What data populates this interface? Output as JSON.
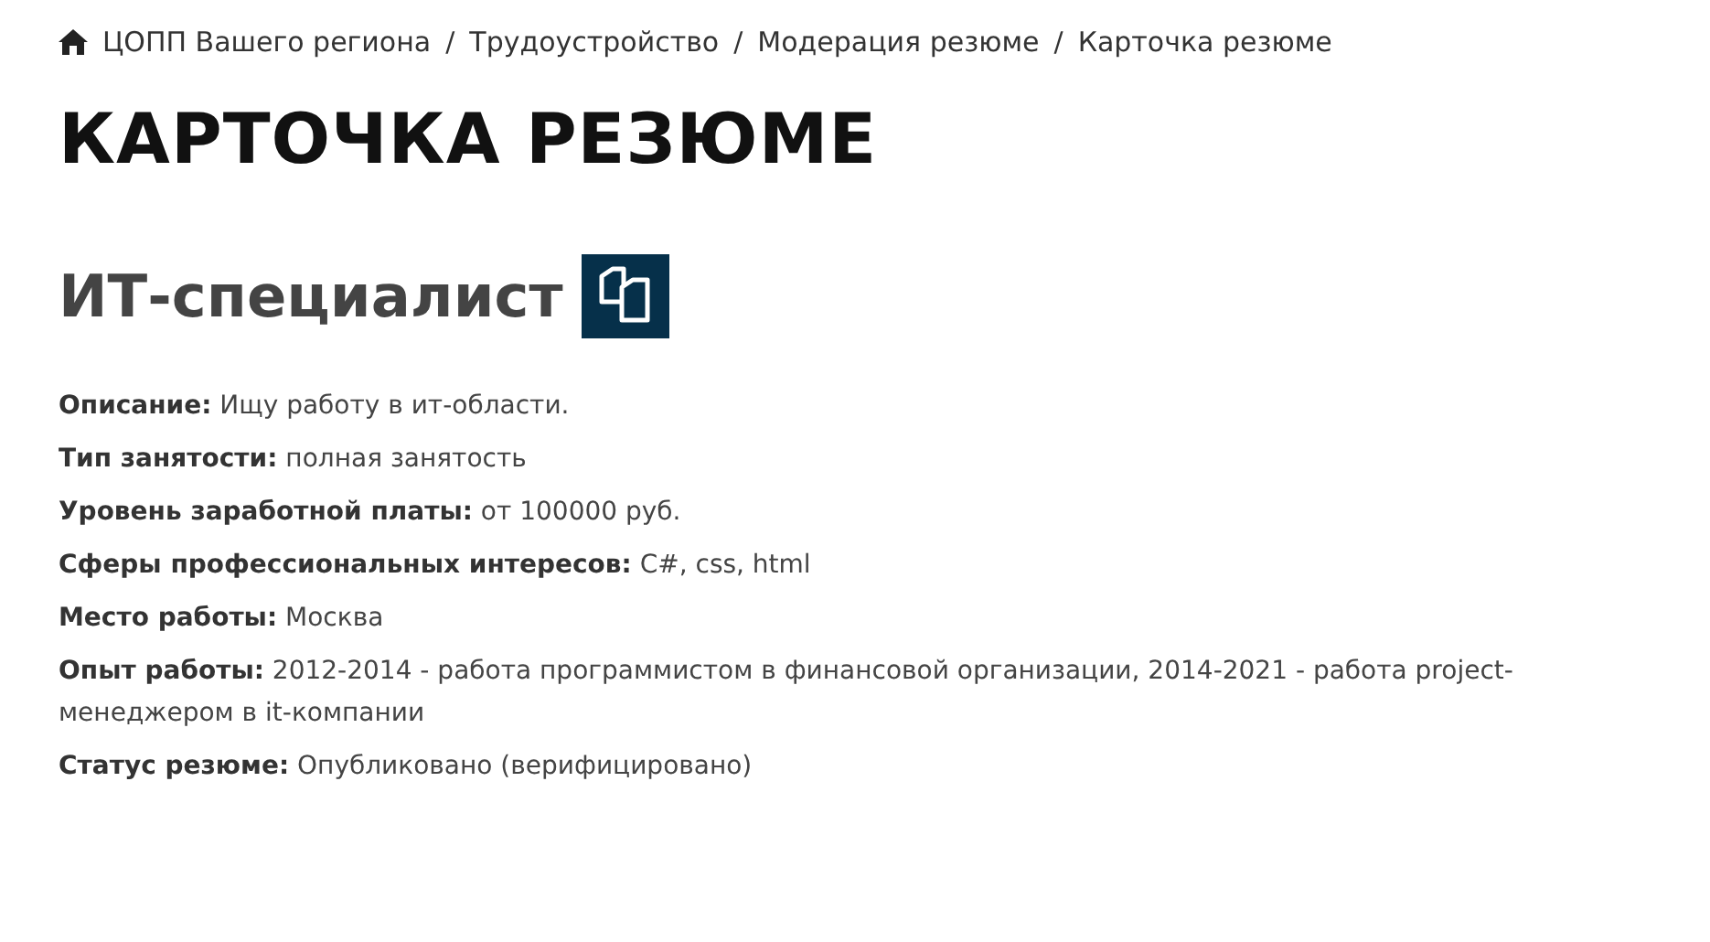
{
  "breadcrumbs": [
    {
      "label": "ЦОПП Вашего региона",
      "kind": "home"
    },
    {
      "label": "Трудоустройство",
      "kind": "link"
    },
    {
      "label": "Модерация резюме",
      "kind": "link"
    },
    {
      "label": "Карточка резюме",
      "kind": "current"
    }
  ],
  "separator": "/",
  "page_title": "КАРТОЧКА РЕЗЮМЕ",
  "resume_title": "ИТ-специалист",
  "details": [
    {
      "label": "Описание:",
      "value": "Ищу работу в ит-области."
    },
    {
      "label": "Тип занятости:",
      "value": "полная занятость"
    },
    {
      "label": "Уровень заработной платы:",
      "value": "от 100000 руб."
    },
    {
      "label": "Сферы профессиональных интересов:",
      "value": "C#, css, html"
    },
    {
      "label": "Место работы:",
      "value": "Москва"
    },
    {
      "label": "Опыт работы:",
      "value": "2012-2014 - работа программистом в финансовой организации, 2014-2021 - работа project-менеджером в it-компании"
    },
    {
      "label": "Статус резюме:",
      "value": "Опубликовано (верифицировано)"
    }
  ]
}
